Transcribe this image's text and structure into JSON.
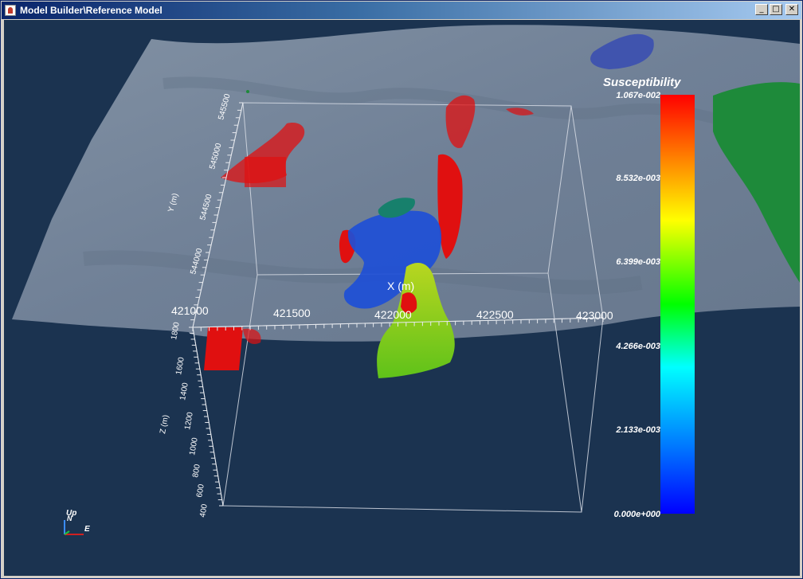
{
  "window": {
    "title": "Model Builder\\Reference Model",
    "buttons": {
      "minimize": "_",
      "maximize": "□",
      "close": "✕"
    }
  },
  "viewport": {
    "x_axis": {
      "label": "X (m)",
      "ticks": [
        "421000",
        "421500",
        "422000",
        "422500",
        "423000"
      ]
    },
    "y_axis": {
      "label": "Y (m)",
      "ticks": [
        "545500",
        "545000",
        "544500",
        "544000"
      ]
    },
    "z_axis": {
      "label": "Z (m)",
      "ticks": [
        "1800",
        "1600",
        "1400",
        "1200",
        "1000",
        "800",
        "600",
        "400"
      ]
    },
    "colorbar": {
      "title": "Susceptibility",
      "labels": [
        "1.067e-002",
        "8.532e-003",
        "6.399e-003",
        "4.266e-003",
        "2.133e-003",
        "0.000e+000"
      ]
    },
    "orientation": {
      "up": "Up",
      "north": "N",
      "east": "E"
    },
    "colors": {
      "background": "#1b3350",
      "terrain": "#7f8ea0",
      "high": "#e01010",
      "low": "#1e4fd6",
      "mid": "#8fd21a",
      "green_body": "#1e8a3a"
    }
  }
}
